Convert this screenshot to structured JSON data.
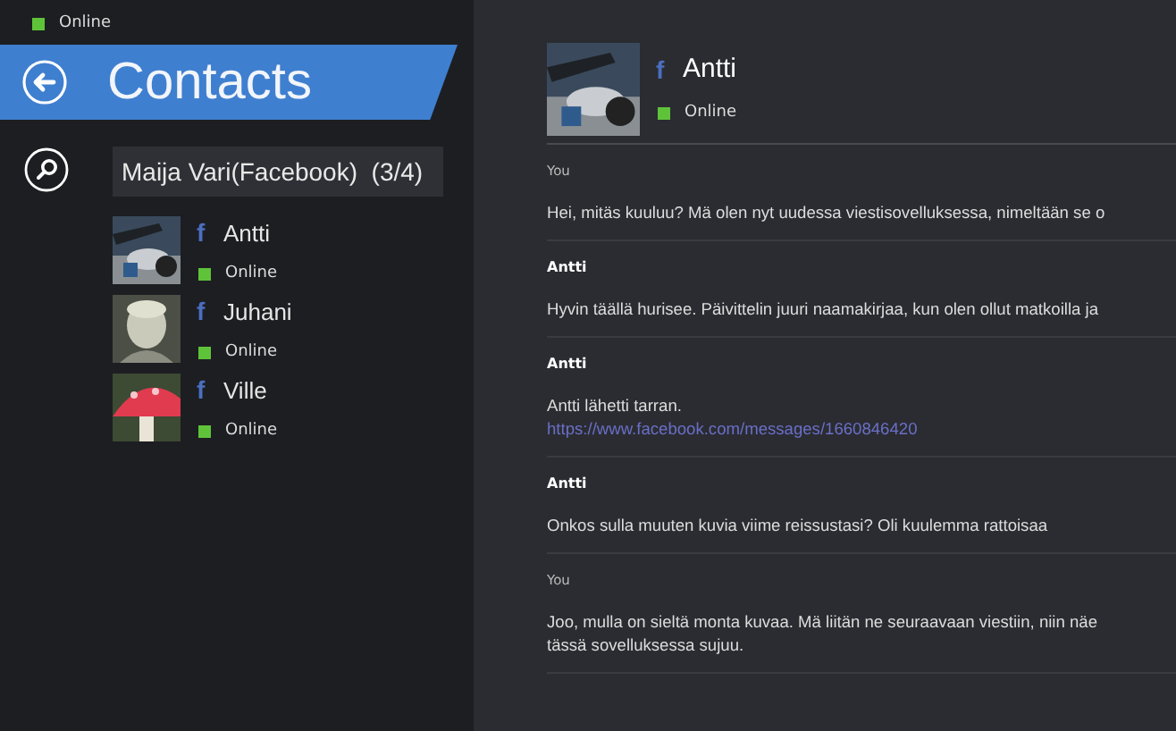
{
  "status": {
    "text": "Online",
    "color": "#5fc33a"
  },
  "header": {
    "title": "Contacts"
  },
  "search": {
    "value": "Maija Vari(Facebook)",
    "count": "(3/4)"
  },
  "contacts": [
    {
      "network": "f",
      "name": "Antti",
      "status": "Online",
      "color": "#5fc33a"
    },
    {
      "network": "f",
      "name": "Juhani",
      "status": "Online",
      "color": "#5fc33a"
    },
    {
      "network": "f",
      "name": "Ville",
      "status": "Online",
      "color": "#5fc33a"
    }
  ],
  "conversation": {
    "network": "f",
    "name": "Antti",
    "status": "Online",
    "color": "#5fc33a"
  },
  "messages": [
    {
      "sender": "You",
      "kind": "self",
      "lines": [
        "Hei, mitäs kuuluu? Mä olen nyt uudessa viestisovelluksessa, nimeltään se o"
      ]
    },
    {
      "sender": "Antti",
      "kind": "other",
      "lines": [
        "Hyvin täällä hurisee. Päivittelin juuri naamakirjaa, kun olen ollut matkoilla ja"
      ]
    },
    {
      "sender": "Antti",
      "kind": "other",
      "lines": [
        "Antti lähetti tarran."
      ],
      "link": "https://www.facebook.com/messages/1660846420"
    },
    {
      "sender": "Antti",
      "kind": "other",
      "lines": [
        "Onkos sulla muuten kuvia viime reissustasi? Oli kuulemma rattoisaa"
      ]
    },
    {
      "sender": "You",
      "kind": "self",
      "lines": [
        "Joo, mulla on sieltä monta kuvaa. Mä liitän ne seuraavaan viestiin, niin näe",
        "tässä sovelluksessa sujuu."
      ]
    }
  ]
}
